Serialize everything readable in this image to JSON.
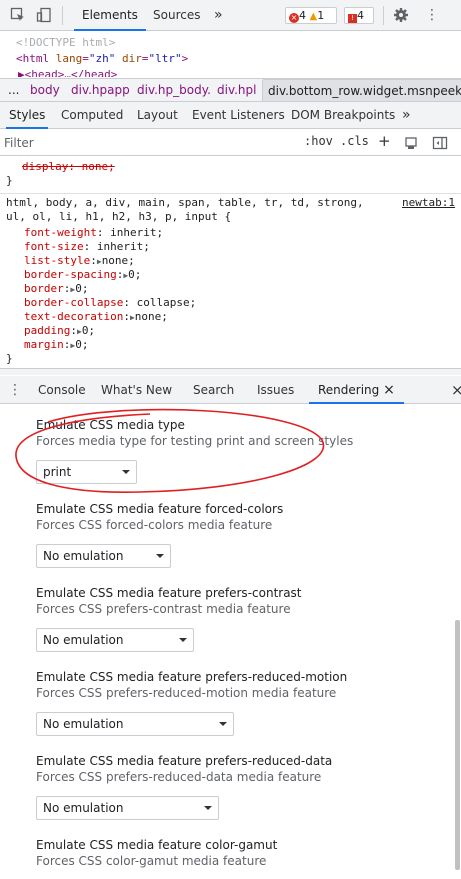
{
  "toolbar": {
    "tabs": [
      "Elements",
      "Sources"
    ],
    "more": "»",
    "errors": "4",
    "warnings": "1",
    "issues": "4",
    "menu": "⋮"
  },
  "html_preview": {
    "line1": "<!DOCTYPE html>",
    "line2_tag_open": "<html ",
    "line2_attr1": "lang",
    "line2_val1": "\"zh\"",
    "line2_attr2": "dir",
    "line2_val2": "\"ltr\"",
    "line2_close": ">",
    "line3": "▶<head>…</head>"
  },
  "breadcrumbs": {
    "ellipsis": "...",
    "items": [
      "body",
      "div.hpapp",
      "div.hp_body.",
      "div.hpl",
      "div.bottom_row.widget.msnpeek"
    ]
  },
  "styles_tabs": {
    "items": [
      "Styles",
      "Computed",
      "Layout",
      "Event Listeners",
      "DOM Breakpoints"
    ],
    "more": "»"
  },
  "filter": {
    "placeholder": "Filter",
    "hov": ":hov",
    "cls": ".cls",
    "add": "+"
  },
  "rules": {
    "prev_prop": "display",
    "prev_val": "none;",
    "prev_close": "}",
    "selector_line1": "html, body, a, div, main, span, table, tr, td, strong,",
    "selector_line2": "ul, ol, li, h1, h2, h3, p, input {",
    "source": "newtab:1",
    "declarations": [
      {
        "prop": "font-weight",
        "val": "inherit;",
        "expand": false
      },
      {
        "prop": "font-size",
        "val": "inherit;",
        "expand": false
      },
      {
        "prop": "list-style",
        "val": "none;",
        "expand": true
      },
      {
        "prop": "border-spacing",
        "val": "0;",
        "expand": true
      },
      {
        "prop": "border",
        "val": "0;",
        "expand": true
      },
      {
        "prop": "border-collapse",
        "val": "collapse;",
        "expand": false
      },
      {
        "prop": "text-decoration",
        "val": "none;",
        "expand": true
      },
      {
        "prop": "padding",
        "val": "0;",
        "expand": true
      },
      {
        "prop": "margin",
        "val": "0;",
        "expand": true
      }
    ],
    "close": "}"
  },
  "drawer": {
    "tabs": [
      "Console",
      "What's New",
      "Search",
      "Issues",
      "Rendering"
    ],
    "close": "×"
  },
  "rendering": {
    "options": [
      {
        "title": "Emulate CSS media type",
        "desc": "Forces media type for testing print and screen styles",
        "value": "print"
      },
      {
        "title": "Emulate CSS media feature forced-colors",
        "desc": "Forces CSS forced-colors media feature",
        "value": "No emulation"
      },
      {
        "title": "Emulate CSS media feature prefers-contrast",
        "desc": "Forces CSS prefers-contrast media feature",
        "value": "No emulation"
      },
      {
        "title": "Emulate CSS media feature prefers-reduced-motion",
        "desc": "Forces CSS prefers-reduced-motion media feature",
        "value": "No emulation"
      },
      {
        "title": "Emulate CSS media feature prefers-reduced-data",
        "desc": "Forces CSS prefers-reduced-data media feature",
        "value": "No emulation"
      },
      {
        "title": "Emulate CSS media feature color-gamut",
        "desc": "Forces CSS color-gamut media feature",
        "value": ""
      }
    ]
  },
  "colors": {
    "annotation": "#e02020",
    "accent": "#1a73e8"
  }
}
